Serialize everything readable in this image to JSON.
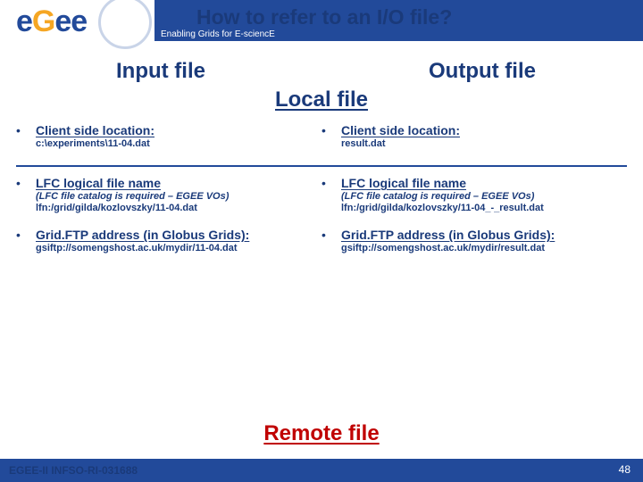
{
  "header": {
    "title": "How to refer to an I/O file?",
    "subtitle": "Enabling Grids for E-sciencE"
  },
  "logo": {
    "e1": "e",
    "g": "G",
    "e2": "e",
    "e3": "e"
  },
  "columns": {
    "left_title": "Input file",
    "right_title": "Output file"
  },
  "local_label": "Local file",
  "remote_label": "Remote file",
  "left": {
    "a_head": "Client side location:",
    "a_sub": "c:\\experiments\\11-04.dat",
    "b_head": "LFC logical file name",
    "b_sub1": "(LFC file catalog is required – EGEE VOs)",
    "b_sub2": "lfn:/grid/gilda/kozlovszky/11-04.dat",
    "c_head": "Grid.FTP address (in Globus Grids):",
    "c_sub": "gsiftp://somengshost.ac.uk/mydir/11-04.dat"
  },
  "right": {
    "a_head": "Client side location:",
    "a_sub": "result.dat",
    "b_head": "LFC logical file name",
    "b_sub1": "(LFC file catalog is required – EGEE VOs)",
    "b_sub2": "lfn:/grid/gilda/kozlovszky/11-04_-_result.dat",
    "c_head": "Grid.FTP address (in Globus Grids):",
    "c_sub": "gsiftp://somengshost.ac.uk/mydir/result.dat"
  },
  "footer": {
    "left": "EGEE-II INFSO-RI-031688",
    "page": "48"
  }
}
